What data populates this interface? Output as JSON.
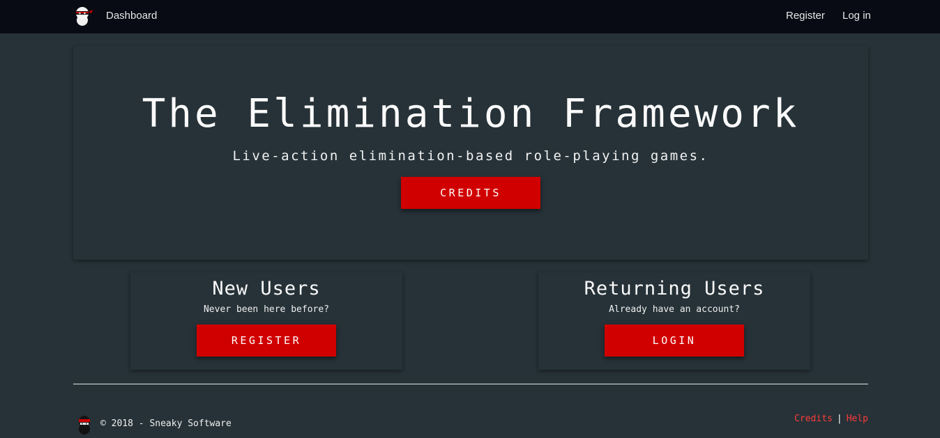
{
  "nav": {
    "brand_icon": "ninja-logo-icon",
    "dashboard_label": "Dashboard",
    "register_label": "Register",
    "login_label": "Log in"
  },
  "hero": {
    "title": "The Elimination Framework",
    "subtitle": "Live-action elimination-based role-playing games.",
    "credits_button": "CREDITS"
  },
  "cards": {
    "new_users": {
      "title": "New Users",
      "subtitle": "Never been here before?",
      "button": "REGISTER"
    },
    "returning_users": {
      "title": "Returning Users",
      "subtitle": "Already have an account?",
      "button": "LOGIN"
    }
  },
  "footer": {
    "logo_icon": "ninja-footer-icon",
    "copyright": "© 2018 - Sneaky Software",
    "credits_link": "Credits",
    "separator": "|",
    "help_link": "Help"
  },
  "colors": {
    "background": "#263238",
    "navbar": "#090b14",
    "accent": "#d10000",
    "link": "#ff3b3b"
  }
}
